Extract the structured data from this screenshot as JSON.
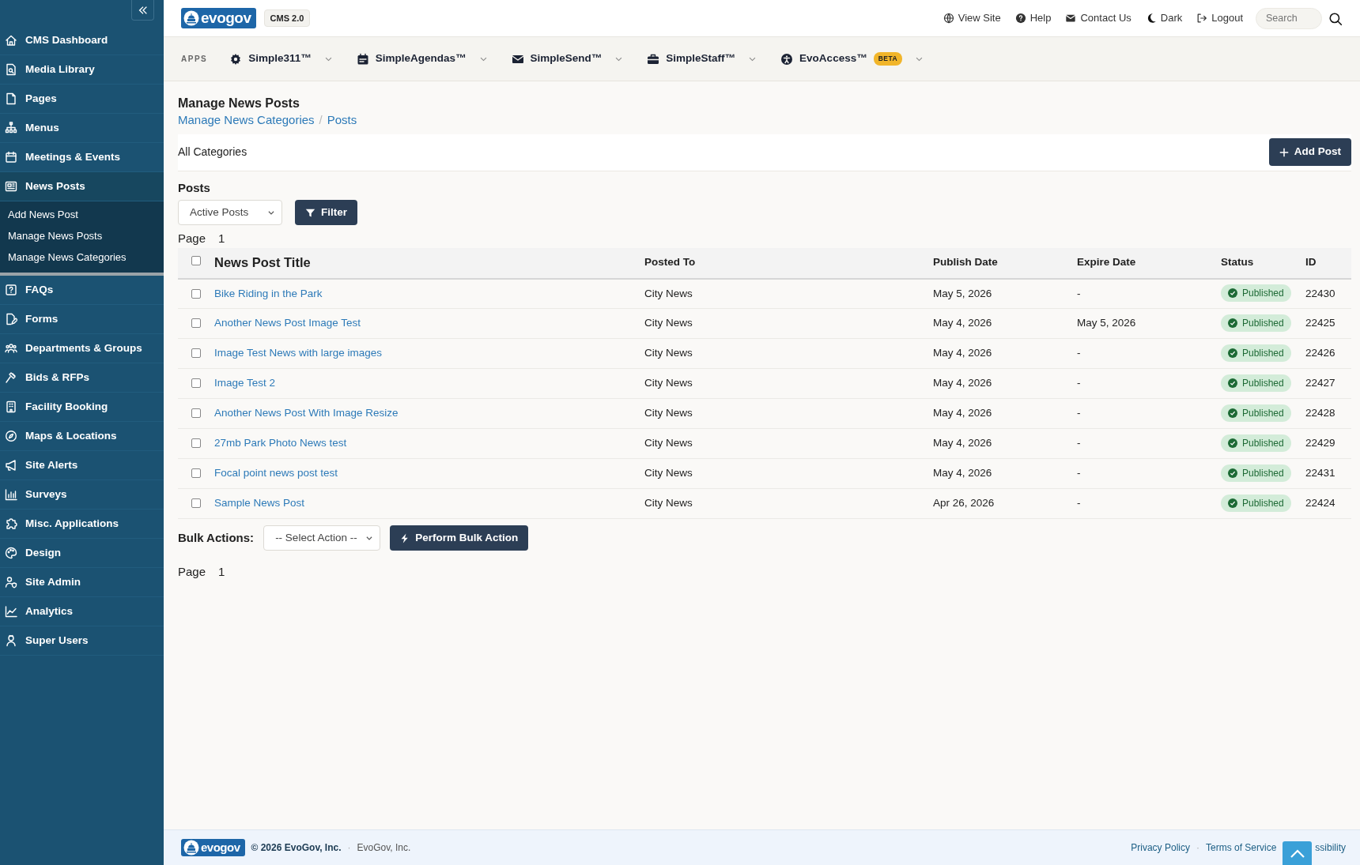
{
  "brand": {
    "logo": "evogov",
    "version": "CMS 2.0"
  },
  "sidebar": {
    "items": [
      {
        "label": "CMS Dashboard",
        "selected": false
      },
      {
        "label": "Media Library",
        "selected": false
      },
      {
        "label": "Pages",
        "selected": false
      },
      {
        "label": "Menus",
        "selected": false
      },
      {
        "label": "Meetings & Events",
        "selected": false
      },
      {
        "label": "News Posts",
        "selected": true,
        "expanded": true,
        "children": [
          {
            "label": "Add News Post"
          },
          {
            "label": "Manage News Posts"
          },
          {
            "label": "Manage News Categories"
          }
        ]
      },
      {
        "label": "FAQs",
        "selected": false
      },
      {
        "label": "Forms",
        "selected": false
      },
      {
        "label": "Departments & Groups",
        "selected": false
      },
      {
        "label": "Bids & RFPs",
        "selected": false
      },
      {
        "label": "Facility Booking",
        "selected": false
      },
      {
        "label": "Maps & Locations",
        "selected": false
      },
      {
        "label": "Site Alerts",
        "selected": false
      },
      {
        "label": "Surveys",
        "selected": false
      },
      {
        "label": "Misc. Applications",
        "selected": false
      },
      {
        "label": "Design",
        "selected": false
      },
      {
        "label": "Site Admin",
        "selected": false
      },
      {
        "label": "Analytics",
        "selected": false
      },
      {
        "label": "Super Users",
        "selected": false
      }
    ]
  },
  "top_links": [
    {
      "label": "View Site"
    },
    {
      "label": "Help"
    },
    {
      "label": "Contact Us"
    },
    {
      "label": "Dark"
    },
    {
      "label": "Logout"
    }
  ],
  "search": {
    "placeholder": "Search"
  },
  "apps": {
    "label": "APPS",
    "items": [
      {
        "label": "Simple311™"
      },
      {
        "label": "SimpleAgendas™"
      },
      {
        "label": "SimpleSend™"
      },
      {
        "label": "SimpleStaff™"
      },
      {
        "label": "EvoAccess™",
        "badge": "BETA"
      }
    ]
  },
  "page": {
    "title": "Manage News Posts",
    "breadcrumb": [
      "Manage News Categories",
      "Posts"
    ],
    "breadcrumb_separator": "/",
    "category": "All Categories",
    "add_button": "Add Post",
    "section": "Posts",
    "filter_select": "Active Posts",
    "filter_button": "Filter",
    "page_label": "Page",
    "page_number": "1"
  },
  "table": {
    "select_all_checked": false,
    "columns": [
      "News Post Title",
      "Posted To",
      "Publish Date",
      "Expire Date",
      "Status",
      "ID"
    ],
    "rows": [
      {
        "checked": false,
        "title": "Bike Riding in the Park",
        "posted_to": "City News",
        "publish": "May 5, 2026",
        "expire": "-",
        "status": "Published",
        "id": "22430"
      },
      {
        "checked": false,
        "title": "Another News Post Image Test",
        "posted_to": "City News",
        "publish": "May 4, 2026",
        "expire": "May 5, 2026",
        "status": "Published",
        "id": "22425"
      },
      {
        "checked": false,
        "title": "Image Test News with large images",
        "posted_to": "City News",
        "publish": "May 4, 2026",
        "expire": "-",
        "status": "Published",
        "id": "22426"
      },
      {
        "checked": false,
        "title": "Image Test 2",
        "posted_to": "City News",
        "publish": "May 4, 2026",
        "expire": "-",
        "status": "Published",
        "id": "22427"
      },
      {
        "checked": false,
        "title": "Another News Post With Image Resize",
        "posted_to": "City News",
        "publish": "May 4, 2026",
        "expire": "-",
        "status": "Published",
        "id": "22428"
      },
      {
        "checked": false,
        "title": "27mb Park Photo News test",
        "posted_to": "City News",
        "publish": "May 4, 2026",
        "expire": "-",
        "status": "Published",
        "id": "22429"
      },
      {
        "checked": false,
        "title": "Focal point news post test",
        "posted_to": "City News",
        "publish": "May 4, 2026",
        "expire": "-",
        "status": "Published",
        "id": "22431"
      },
      {
        "checked": false,
        "title": "Sample News Post",
        "posted_to": "City News",
        "publish": "Apr 26, 2026",
        "expire": "-",
        "status": "Published",
        "id": "22424"
      }
    ]
  },
  "bulk": {
    "label": "Bulk Actions:",
    "select": "-- Select Action --",
    "button": "Perform Bulk Action"
  },
  "bottom_page": {
    "label": "Page",
    "number": "1"
  },
  "footer": {
    "logo": "evogov",
    "copyright": "© 2026 EvoGov, Inc.",
    "separator": "·",
    "company": "EvoGov, Inc.",
    "links": [
      "Privacy Policy",
      "Terms of Service",
      "ssibility"
    ]
  }
}
